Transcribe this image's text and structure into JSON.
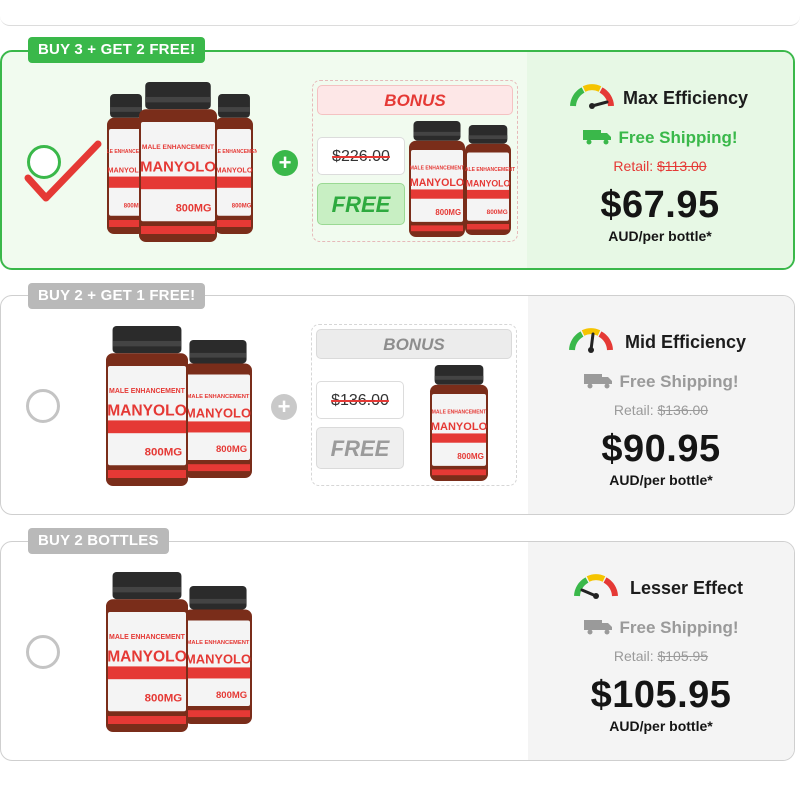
{
  "offers": [
    {
      "badge": "BUY 3 + GET 2 FREE!",
      "selected": true,
      "bonus_label": "BONUS",
      "bonus_old_price": "$226.00",
      "bonus_free": "FREE",
      "efficiency": "Max Efficiency",
      "shipping": "Free Shipping!",
      "retail_label": "Retail:",
      "retail_price": "$113.00",
      "price": "$67.95",
      "per_unit": "AUD/per bottle*",
      "bottles_main": 3,
      "bottles_bonus": 2
    },
    {
      "badge": "BUY 2 + GET 1 FREE!",
      "selected": false,
      "bonus_label": "BONUS",
      "bonus_old_price": "$136.00",
      "bonus_free": "FREE",
      "efficiency": "Mid Efficiency",
      "shipping": "Free Shipping!",
      "retail_label": "Retail:",
      "retail_price": "$136.00",
      "price": "$90.95",
      "per_unit": "AUD/per bottle*",
      "bottles_main": 2,
      "bottles_bonus": 1
    },
    {
      "badge": "BUY 2 BOTTLES",
      "selected": false,
      "efficiency": "Lesser Effect",
      "shipping": "Free Shipping!",
      "retail_label": "Retail:",
      "retail_price": "$105.95",
      "price": "$105.95",
      "per_unit": "AUD/per bottle*",
      "bottles_main": 2
    }
  ],
  "product": {
    "label_line1": "MALE ENHANCEMENT",
    "label_line2": "MANYOLO",
    "dose": "800MG"
  },
  "colors": {
    "accent_green": "#3ab84a",
    "accent_red": "#e53935",
    "grey": "#b9b9b9"
  },
  "icons": {
    "selected": "checkmark-icon",
    "add": "plus-icon",
    "shipping": "truck-icon",
    "efficiency": "gauge-icon"
  }
}
